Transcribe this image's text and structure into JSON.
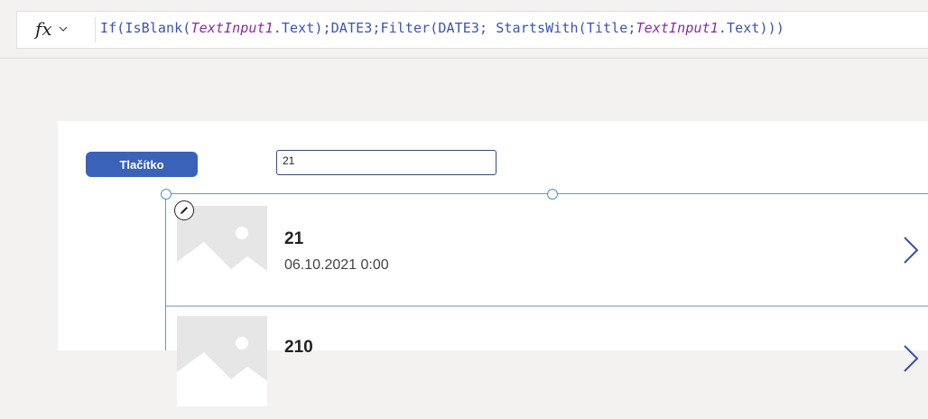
{
  "formula_bar": {
    "fx_label": "fx",
    "tokens": [
      {
        "t": "If(IsBlank(",
        "k": "fn"
      },
      {
        "t": "TextInput1",
        "k": "ctl"
      },
      {
        "t": ".Text);DATE3;Filter(DATE3; StartsWith(Title;",
        "k": "fn"
      },
      {
        "t": "TextInput1",
        "k": "ctl"
      },
      {
        "t": ".Text)))",
        "k": "fn"
      }
    ]
  },
  "canvas": {
    "button_label": "Tlačítko",
    "text_input_value": "21"
  },
  "gallery": {
    "items": [
      {
        "title": "21",
        "subtitle": "06.10.2021 0:00"
      },
      {
        "title": "210",
        "subtitle": ""
      }
    ]
  },
  "colors": {
    "button": "#3a62b8",
    "selection": "#5a9bd5",
    "function_text": "#3b53b3",
    "control_ref": "#8a2aa6"
  },
  "icons": [
    "fx-icon",
    "chevron-down-icon",
    "edit-icon",
    "image-placeholder-icon",
    "chevron-right-icon"
  ]
}
